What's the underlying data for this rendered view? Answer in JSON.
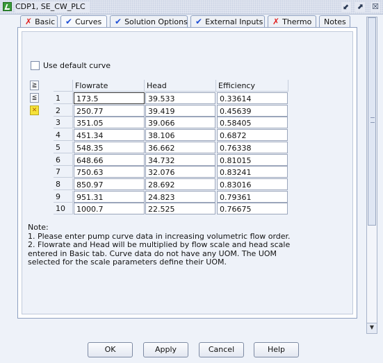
{
  "window": {
    "title": "CDP1, SE_CW_PLC",
    "minimize_glyph": "⬋",
    "maximize_glyph": "⬈",
    "close_glyph": "☒"
  },
  "tabs": [
    {
      "label": "Basic",
      "status": "error"
    },
    {
      "label": "Curves",
      "status": "ok",
      "active": true
    },
    {
      "label": "Solution Options",
      "status": "ok"
    },
    {
      "label": "External Inputs",
      "status": "ok"
    },
    {
      "label": "Thermo",
      "status": "error"
    },
    {
      "label": "Notes",
      "status": "none"
    }
  ],
  "curves": {
    "use_default_label": "Use default curve",
    "use_default_checked": false,
    "columns": [
      "Flowrate",
      "Head",
      "Efficiency"
    ],
    "rows": [
      {
        "n": "1",
        "flowrate": "173.5",
        "head": "39.533",
        "efficiency": "0.33614"
      },
      {
        "n": "2",
        "flowrate": "250.77",
        "head": "39.419",
        "efficiency": "0.45639"
      },
      {
        "n": "3",
        "flowrate": "351.05",
        "head": "39.066",
        "efficiency": "0.58405"
      },
      {
        "n": "4",
        "flowrate": "451.34",
        "head": "38.106",
        "efficiency": "0.6872"
      },
      {
        "n": "5",
        "flowrate": "548.35",
        "head": "36.662",
        "efficiency": "0.76338"
      },
      {
        "n": "6",
        "flowrate": "648.66",
        "head": "34.732",
        "efficiency": "0.81015"
      },
      {
        "n": "7",
        "flowrate": "750.63",
        "head": "32.076",
        "efficiency": "0.83241"
      },
      {
        "n": "8",
        "flowrate": "850.97",
        "head": "28.692",
        "efficiency": "0.83016"
      },
      {
        "n": "9",
        "flowrate": "951.31",
        "head": "24.823",
        "efficiency": "0.79361"
      },
      {
        "n": "10",
        "flowrate": "1000.7",
        "head": "22.525",
        "efficiency": "0.76675"
      }
    ],
    "note_title": "Note:",
    "note_line1": "1. Please enter pump curve data in increasing volumetric flow order.",
    "note_line2": "2. Flowrate and Head will be multiplied by flow scale and head scale entered in Basic tab. Curve data do not have any UOM. The UOM selected for the scale parameters define their UOM."
  },
  "buttons": {
    "ok": "OK",
    "apply": "Apply",
    "cancel": "Cancel",
    "help": "Help"
  },
  "colors": {
    "error_mark": "#e02020",
    "ok_mark": "#1f4fd6",
    "title_icon": "#3a9a3a"
  }
}
